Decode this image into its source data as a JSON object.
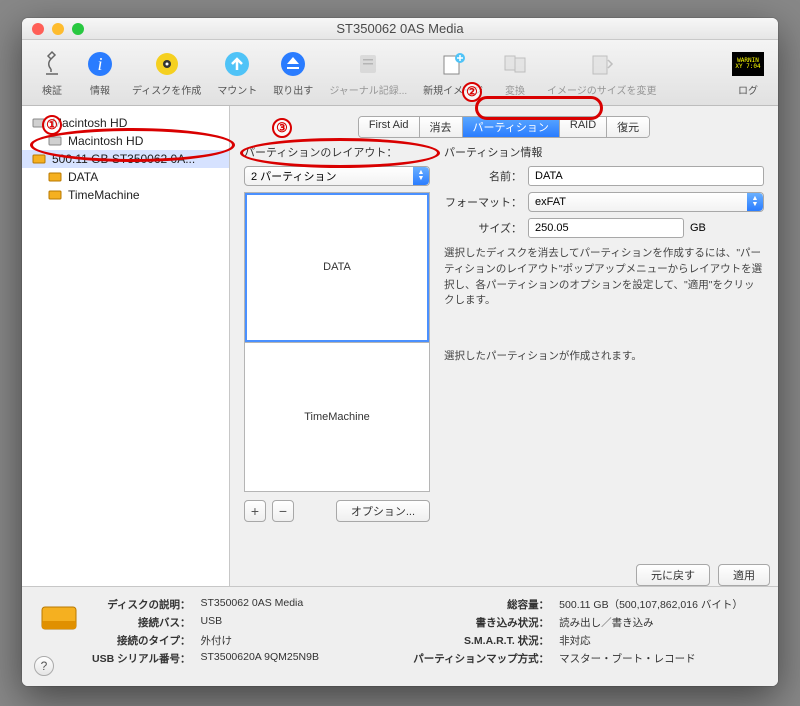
{
  "window": {
    "title": "ST350062 0AS Media"
  },
  "toolbar": [
    {
      "key": "verify",
      "label": "検証",
      "enabled": true
    },
    {
      "key": "info",
      "label": "情報",
      "enabled": true
    },
    {
      "key": "burn",
      "label": "ディスクを作成",
      "enabled": true
    },
    {
      "key": "mount",
      "label": "マウント",
      "enabled": true
    },
    {
      "key": "eject",
      "label": "取り出す",
      "enabled": true
    },
    {
      "key": "journal",
      "label": "ジャーナル記録...",
      "enabled": false
    },
    {
      "key": "newimage",
      "label": "新規イメージ",
      "enabled": true
    },
    {
      "key": "convert",
      "label": "変換",
      "enabled": false
    },
    {
      "key": "resize",
      "label": "イメージのサイズを変更",
      "enabled": false
    },
    {
      "key": "log",
      "label": "ログ",
      "enabled": true
    }
  ],
  "sidebar": [
    {
      "label": "Macintosh HD",
      "icon": "hdd",
      "child": false
    },
    {
      "label": "Macintosh HD",
      "icon": "hdd",
      "child": true
    },
    {
      "label": "500.11 GB ST350062 0A...",
      "icon": "external",
      "child": false,
      "selected": true
    },
    {
      "label": "DATA",
      "icon": "external",
      "child": true
    },
    {
      "label": "TimeMachine",
      "icon": "external",
      "child": true
    }
  ],
  "tabs": {
    "items": [
      "First Aid",
      "消去",
      "パーティション",
      "RAID",
      "復元"
    ],
    "active": 2
  },
  "layout": {
    "heading": "パーティションのレイアウト：",
    "popup": "2 パーティション",
    "partitions": [
      {
        "name": "DATA",
        "selected": true
      },
      {
        "name": "TimeMachine",
        "selected": false
      }
    ],
    "options_btn": "オプション...",
    "add": "+",
    "remove": "−"
  },
  "info": {
    "heading": "パーティション情報",
    "name_label": "名前：",
    "name_value": "DATA",
    "format_label": "フォーマット：",
    "format_value": "exFAT",
    "size_label": "サイズ：",
    "size_value": "250.05",
    "size_unit": "GB",
    "help1": "選択したディスクを消去してパーティションを作成するには、\"パーティションのレイアウト\"ポップアップメニューからレイアウトを選択し、各パーティションのオプションを設定して、\"適用\"をクリックします。",
    "help2": "選択したパーティションが作成されます。",
    "revert_btn": "元に戻す",
    "apply_btn": "適用"
  },
  "footer": {
    "rows": [
      [
        "ディスクの説明：",
        "ST350062 0AS Media",
        "総容量：",
        "500.11 GB（500,107,862,016 バイト）"
      ],
      [
        "接続バス：",
        "USB",
        "書き込み状況：",
        "読み出し／書き込み"
      ],
      [
        "接続のタイプ：",
        "外付け",
        "S.M.A.R.T. 状況：",
        "非対応"
      ],
      [
        "USB シリアル番号：",
        "ST3500620A          9QM25N9B",
        "パーティションマップ方式：",
        "マスター・ブート・レコード"
      ]
    ]
  },
  "annotations": {
    "n1": "①",
    "n2": "②",
    "n3": "③"
  }
}
